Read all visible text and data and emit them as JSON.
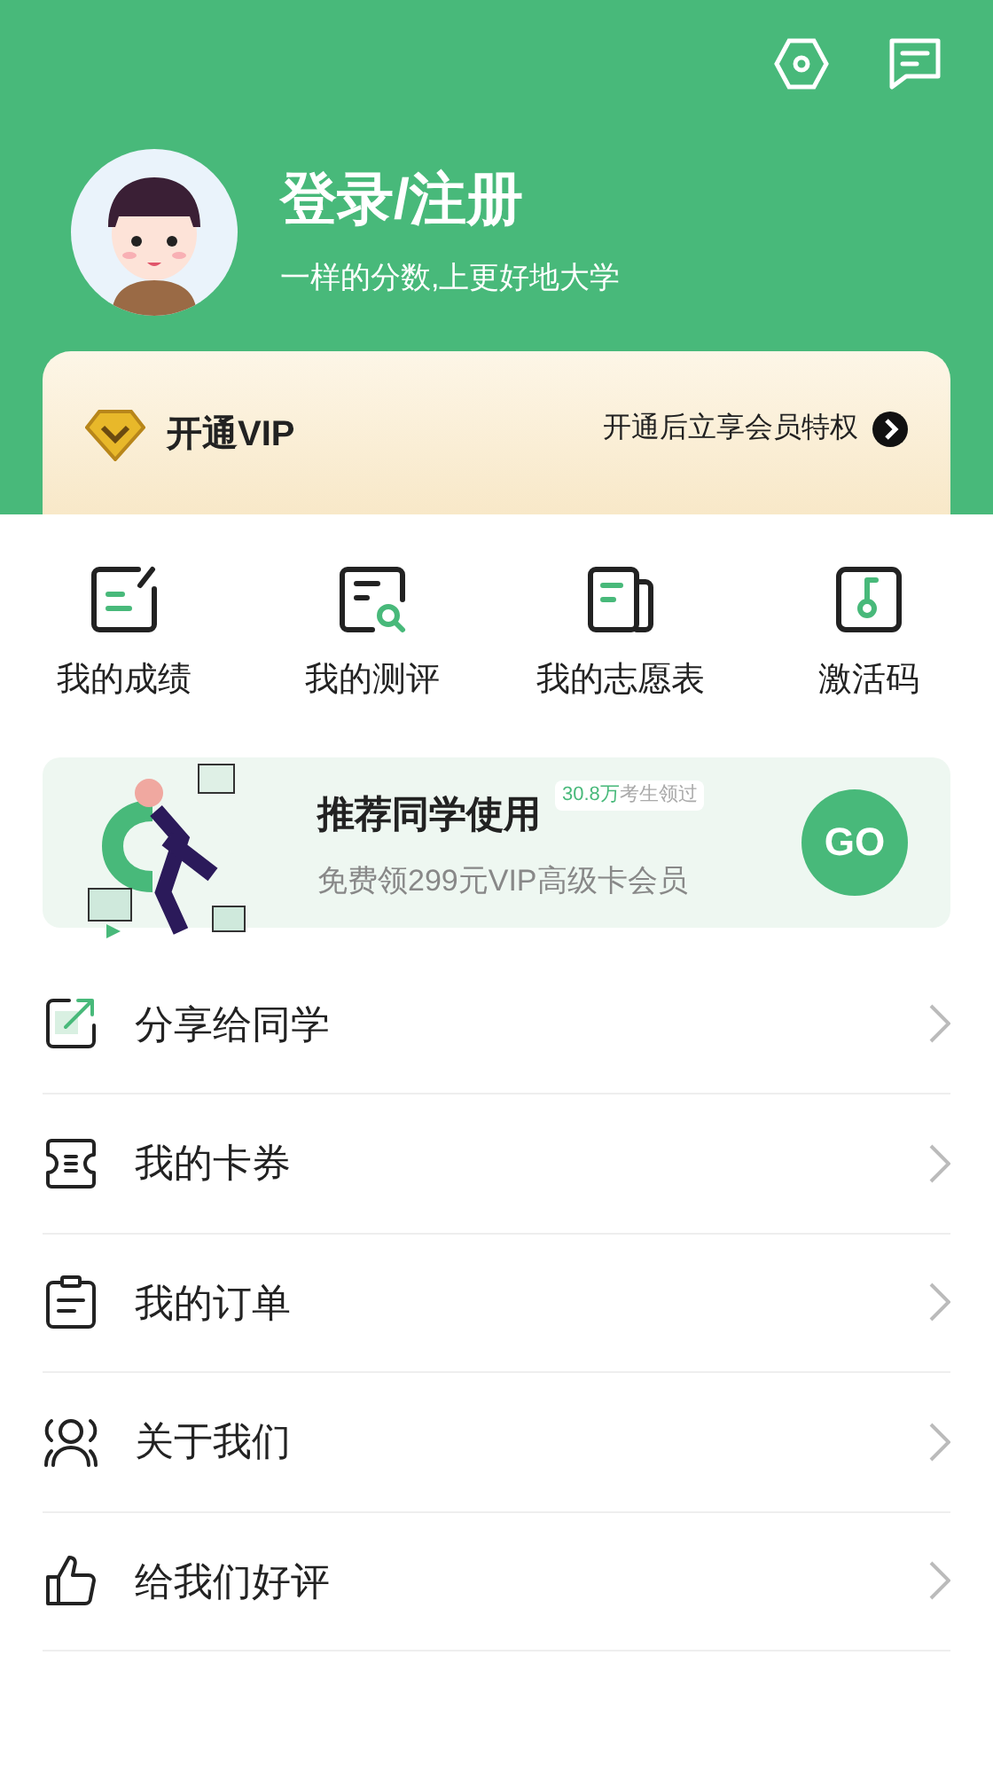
{
  "header": {
    "title": "登录/注册",
    "subtitle": "一样的分数,上更好地大学"
  },
  "vip": {
    "title": "开通VIP",
    "link": "开通后立享会员特权"
  },
  "shortcuts": [
    {
      "kind": "score",
      "label": "我的成绩"
    },
    {
      "kind": "test",
      "label": "我的测评"
    },
    {
      "kind": "wishlist",
      "label": "我的志愿表"
    },
    {
      "kind": "key",
      "label": "激活码"
    }
  ],
  "promo": {
    "title": "推荐同学使用",
    "badge_count": "30.8万",
    "badge_text": "考生领过",
    "subtitle": "免费领299元VIP高级卡会员",
    "button": "GO"
  },
  "menu": [
    {
      "kind": "share",
      "label": "分享给同学"
    },
    {
      "kind": "coupon",
      "label": "我的卡券"
    },
    {
      "kind": "order",
      "label": "我的订单"
    },
    {
      "kind": "about",
      "label": "关于我们"
    },
    {
      "kind": "rate",
      "label": "给我们好评"
    }
  ]
}
